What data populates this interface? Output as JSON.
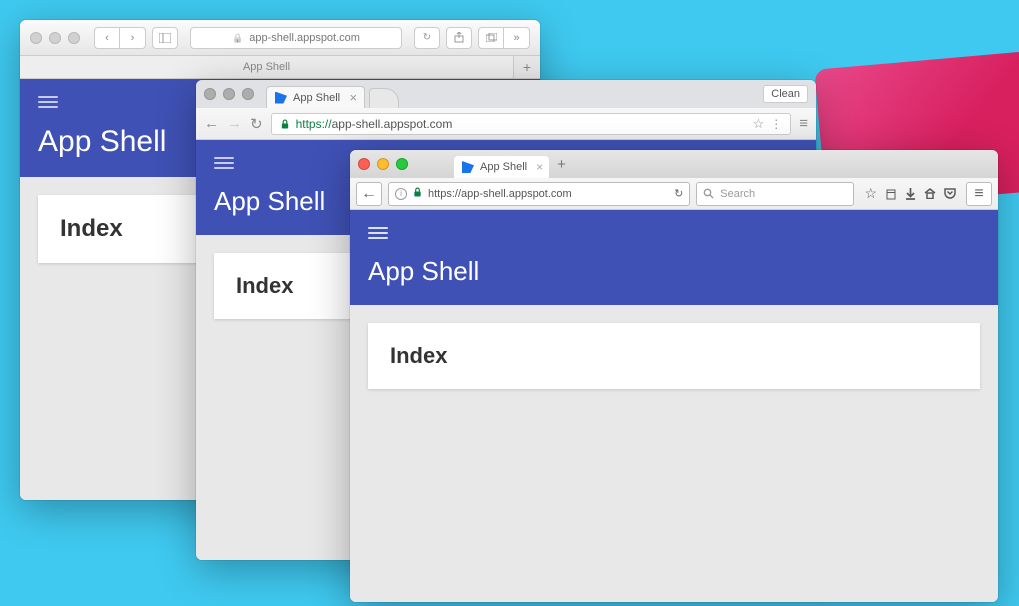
{
  "app": {
    "title": "App Shell",
    "card_heading": "Index"
  },
  "safari": {
    "omnibox_text": "app-shell.appspot.com",
    "tab_label": "App Shell"
  },
  "chrome": {
    "tab_label": "App Shell",
    "clean_button": "Clean",
    "url_scheme": "https://",
    "url_rest": "app-shell.appspot.com"
  },
  "firefox": {
    "tab_label": "App Shell",
    "url": "https://app-shell.appspot.com",
    "search_placeholder": "Search"
  }
}
